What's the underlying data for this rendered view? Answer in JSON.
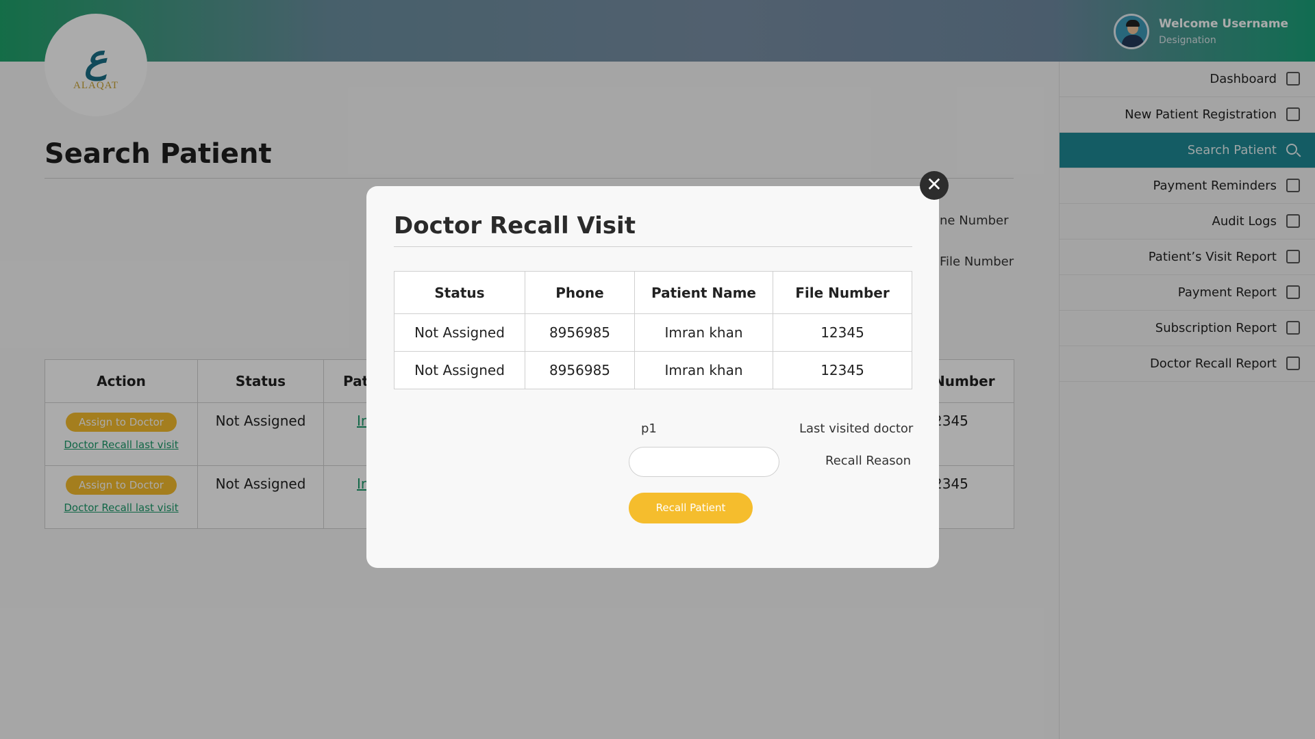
{
  "header": {
    "logo_text": "ALAQAT",
    "user": {
      "welcome": "Welcome Username",
      "designation": "Designation"
    }
  },
  "sidebar": {
    "items": [
      {
        "label": "Dashboard",
        "icon": "dashboard-icon"
      },
      {
        "label": "New Patient Registration",
        "icon": "add-user-icon"
      },
      {
        "label": "Search Patient",
        "icon": "search-icon",
        "active": true
      },
      {
        "label": "Payment Reminders",
        "icon": "calendar-icon"
      },
      {
        "label": "Audit Logs",
        "icon": "document-icon"
      },
      {
        "label": "Patient’s Visit Report",
        "icon": "report-icon"
      },
      {
        "label": "Payment Report",
        "icon": "payment-report-icon"
      },
      {
        "label": "Subscription Report",
        "icon": "subscription-icon"
      },
      {
        "label": "Doctor Recall Report",
        "icon": "recall-report-icon"
      }
    ]
  },
  "main": {
    "page_title": "Search Patient",
    "visible_labels": [
      "one Number",
      "File Number"
    ],
    "table": {
      "headers": [
        "Action",
        "Status",
        "Pat",
        "Number"
      ],
      "rows": [
        {
          "assign_label": "Assign to Doctor",
          "recall_link": "Doctor Recall last visit",
          "status": "Not Assigned",
          "name_partial": "Ir",
          "number_partial": "2345"
        },
        {
          "assign_label": "Assign to Doctor",
          "recall_link": "Doctor Recall last visit",
          "status": "Not Assigned",
          "name_partial": "Ir",
          "number_partial": "2345"
        }
      ]
    }
  },
  "modal": {
    "title": "Doctor Recall Visit",
    "table": {
      "headers": [
        "Status",
        "Phone",
        "Patient Name",
        "File Number"
      ],
      "rows": [
        [
          "Not Assigned",
          "8956985",
          "Imran khan",
          "12345"
        ],
        [
          "Not Assigned",
          "8956985",
          "Imran khan",
          "12345"
        ]
      ]
    },
    "last_visited_value": "p1",
    "last_visited_label": "Last visited doctor",
    "recall_reason_label": "Recall Reason",
    "recall_reason_value": "",
    "recall_button": "Recall Patient",
    "close_icon": "close-icon"
  },
  "colors": {
    "accent": "#f5bd2d",
    "sidebar_active": "#1f8a96",
    "link": "#1a9a6a"
  }
}
